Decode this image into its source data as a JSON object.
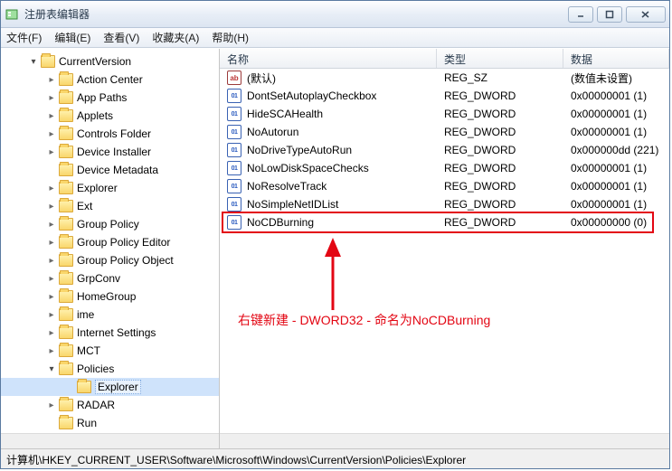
{
  "window": {
    "title": "注册表编辑器"
  },
  "menu": {
    "file": "文件(F)",
    "edit": "编辑(E)",
    "view": "查看(V)",
    "fav": "收藏夹(A)",
    "help": "帮助(H)"
  },
  "tree": [
    {
      "label": "CurrentVersion",
      "depth": 0,
      "state": "col"
    },
    {
      "label": "Action Center",
      "depth": 1,
      "state": "exp"
    },
    {
      "label": "App Paths",
      "depth": 1,
      "state": "exp"
    },
    {
      "label": "Applets",
      "depth": 1,
      "state": "exp"
    },
    {
      "label": "Controls Folder",
      "depth": 1,
      "state": "exp"
    },
    {
      "label": "Device Installer",
      "depth": 1,
      "state": "exp"
    },
    {
      "label": "Device Metadata",
      "depth": 1,
      "state": ""
    },
    {
      "label": "Explorer",
      "depth": 1,
      "state": "exp"
    },
    {
      "label": "Ext",
      "depth": 1,
      "state": "exp"
    },
    {
      "label": "Group Policy",
      "depth": 1,
      "state": "exp"
    },
    {
      "label": "Group Policy Editor",
      "depth": 1,
      "state": "exp"
    },
    {
      "label": "Group Policy Object",
      "depth": 1,
      "state": "exp"
    },
    {
      "label": "GrpConv",
      "depth": 1,
      "state": "exp"
    },
    {
      "label": "HomeGroup",
      "depth": 1,
      "state": "exp"
    },
    {
      "label": "ime",
      "depth": 1,
      "state": "exp"
    },
    {
      "label": "Internet Settings",
      "depth": 1,
      "state": "exp"
    },
    {
      "label": "MCT",
      "depth": 1,
      "state": "exp"
    },
    {
      "label": "Policies",
      "depth": 1,
      "state": "col"
    },
    {
      "label": "Explorer",
      "depth": 2,
      "state": "",
      "selected": true
    },
    {
      "label": "RADAR",
      "depth": 1,
      "state": "exp"
    },
    {
      "label": "Run",
      "depth": 1,
      "state": ""
    }
  ],
  "columns": {
    "name": "名称",
    "type": "类型",
    "data": "数据"
  },
  "values": [
    {
      "name": "(默认)",
      "type": "REG_SZ",
      "data": "(数值未设置)",
      "icon": "str"
    },
    {
      "name": "DontSetAutoplayCheckbox",
      "type": "REG_DWORD",
      "data": "0x00000001 (1)",
      "icon": "dw"
    },
    {
      "name": "HideSCAHealth",
      "type": "REG_DWORD",
      "data": "0x00000001 (1)",
      "icon": "dw"
    },
    {
      "name": "NoAutorun",
      "type": "REG_DWORD",
      "data": "0x00000001 (1)",
      "icon": "dw"
    },
    {
      "name": "NoDriveTypeAutoRun",
      "type": "REG_DWORD",
      "data": "0x000000dd (221)",
      "icon": "dw"
    },
    {
      "name": "NoLowDiskSpaceChecks",
      "type": "REG_DWORD",
      "data": "0x00000001 (1)",
      "icon": "dw"
    },
    {
      "name": "NoResolveTrack",
      "type": "REG_DWORD",
      "data": "0x00000001 (1)",
      "icon": "dw"
    },
    {
      "name": "NoSimpleNetIDList",
      "type": "REG_DWORD",
      "data": "0x00000001 (1)",
      "icon": "dw"
    },
    {
      "name": "NoCDBurning",
      "type": "REG_DWORD",
      "data": "0x00000000 (0)",
      "icon": "dw",
      "hl": true
    }
  ],
  "annotation": "右键新建 - DWORD32 - 命名为NoCDBurning",
  "statusbar": "计算机\\HKEY_CURRENT_USER\\Software\\Microsoft\\Windows\\CurrentVersion\\Policies\\Explorer"
}
